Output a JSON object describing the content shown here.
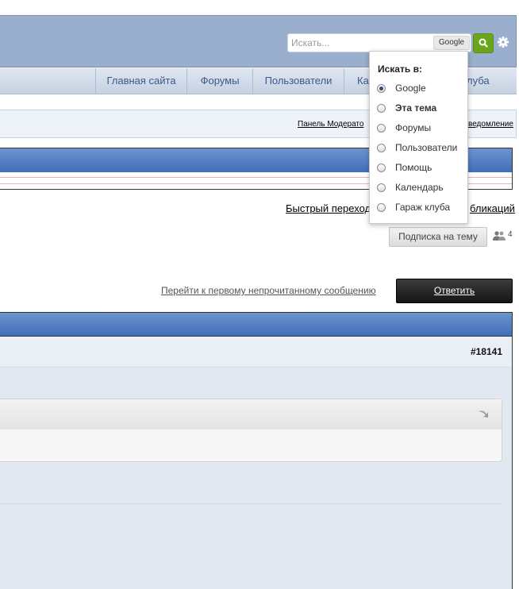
{
  "header": {
    "search": {
      "placeholder": "Искать...",
      "value": "",
      "engine_label": "Google"
    },
    "icons": {
      "search": "search-icon",
      "settings": "gear-icon"
    },
    "accent_color": "#6aa51c"
  },
  "nav": {
    "tabs": [
      {
        "label": "Главная сайта"
      },
      {
        "label": "Форумы"
      },
      {
        "label": "Пользователи"
      },
      {
        "label": "Ка"
      },
      {
        "label": "луба"
      }
    ]
  },
  "modbar": {
    "left_link": "Панель Модерато",
    "right_link": "ведомление"
  },
  "thread_tools": {
    "quick_nav": "Быстрый переход",
    "publications": "бликаций",
    "subscribe": "Подписка на тему",
    "subscribers_count": "4"
  },
  "actions": {
    "first_unread": "Перейти к первому непрочитанному сообщению",
    "reply": "Ответить"
  },
  "post": {
    "number": "#18141"
  },
  "search_dropdown": {
    "title": "Искать в:",
    "options": [
      {
        "label": "Google",
        "selected": true
      },
      {
        "label": "Эта тема",
        "selected": false,
        "bold": true
      },
      {
        "label": "Форумы",
        "selected": false
      },
      {
        "label": "Пользователи",
        "selected": false
      },
      {
        "label": "Помощь",
        "selected": false
      },
      {
        "label": "Календарь",
        "selected": false
      },
      {
        "label": "Гараж клуба",
        "selected": false
      }
    ]
  }
}
